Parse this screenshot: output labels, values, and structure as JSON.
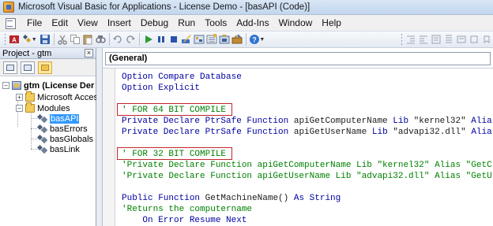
{
  "window": {
    "title": "Microsoft Visual Basic for Applications - License Demo - [basAPI (Code)]"
  },
  "menu": [
    "File",
    "Edit",
    "View",
    "Insert",
    "Debug",
    "Run",
    "Tools",
    "Add-Ins",
    "Window",
    "Help"
  ],
  "toolbar": {
    "icons": [
      "view-access-icon",
      "insert-module-icon",
      "save-icon",
      "cut-icon",
      "copy-icon",
      "paste-icon",
      "find-icon",
      "undo-icon",
      "redo-icon",
      "run-icon",
      "break-icon",
      "reset-icon",
      "design-mode-icon",
      "project-explorer-icon",
      "properties-icon",
      "object-browser-icon",
      "toolbox-icon",
      "help-icon"
    ]
  },
  "project_pane": {
    "title": "Project - gtm",
    "close_glyph": "×",
    "tree": {
      "project": "gtm (License Der",
      "access_objects": "Microsoft Access",
      "modules_folder": "Modules",
      "modules": [
        "basAPI",
        "basErrors",
        "basGlobals",
        "basLink"
      ],
      "selected": "basAPI"
    }
  },
  "code_window": {
    "object_dropdown": "(General)",
    "lines": [
      [
        {
          "t": "Option Compare Database",
          "c": "kw"
        }
      ],
      [
        {
          "t": "Option Explicit",
          "c": "kw"
        }
      ],
      [
        {
          "t": "",
          "c": ""
        }
      ],
      [
        {
          "t": "' FOR 64 BIT COMPILE",
          "c": "cm"
        }
      ],
      [
        {
          "t": "Private Declare PtrSafe Function ",
          "c": "kw"
        },
        {
          "t": "apiGetComputerName ",
          "c": ""
        },
        {
          "t": "Lib ",
          "c": "kw"
        },
        {
          "t": "\"kernel32\" ",
          "c": ""
        },
        {
          "t": "Alias",
          "c": "kw"
        }
      ],
      [
        {
          "t": "Private Declare PtrSafe Function ",
          "c": "kw"
        },
        {
          "t": "apiGetUserName ",
          "c": ""
        },
        {
          "t": "Lib ",
          "c": "kw"
        },
        {
          "t": "\"advapi32.dll\" ",
          "c": ""
        },
        {
          "t": "Alia",
          "c": "kw"
        }
      ],
      [
        {
          "t": "",
          "c": ""
        }
      ],
      [
        {
          "t": "' FOR 32 BIT COMPILE",
          "c": "cm"
        }
      ],
      [
        {
          "t": "'Private Declare Function apiGetComputerName Lib \"kernel32\" Alias \"GetC",
          "c": "cm"
        }
      ],
      [
        {
          "t": "'Private Declare Function apiGetUserName Lib \"advapi32.dll\" Alias \"GetU",
          "c": "cm"
        }
      ],
      [
        {
          "t": "",
          "c": ""
        }
      ],
      [
        {
          "t": "Public Function ",
          "c": "kw"
        },
        {
          "t": "GetMachineName() ",
          "c": ""
        },
        {
          "t": "As String",
          "c": "kw"
        }
      ],
      [
        {
          "t": "'Returns the computername",
          "c": "cm"
        }
      ],
      [
        {
          "t": "    On Error Resume Next",
          "c": "kw"
        }
      ]
    ],
    "highlighted_comment_lines": [
      3,
      7
    ]
  },
  "colors": {
    "keyword": "#0000a0",
    "comment": "#008000",
    "highlight_box": "#c0272d",
    "selection": "#3399ff"
  }
}
